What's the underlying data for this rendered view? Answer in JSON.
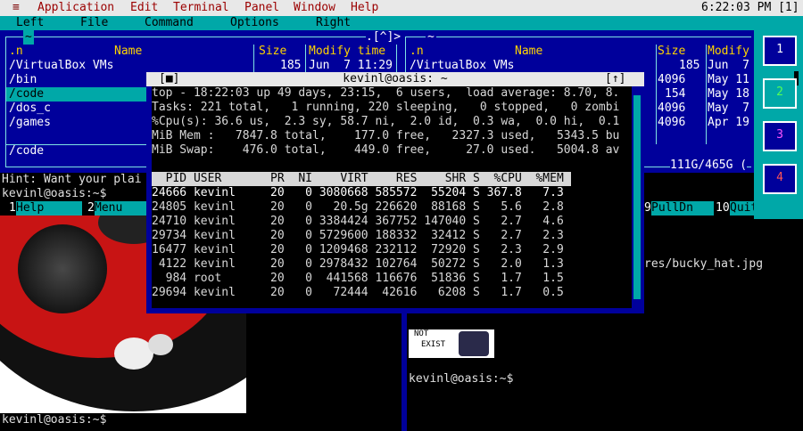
{
  "menubar": {
    "logo": "≡",
    "items": [
      "Application",
      "Edit",
      "Terminal",
      "Panel",
      "Window",
      "Help"
    ],
    "clock": "6:22:03 PM [1]"
  },
  "mc": {
    "menu": [
      "Left",
      "File",
      "Command",
      "Options",
      "Right"
    ],
    "left_panel": {
      "path": "~",
      "path_right": ".[^]>",
      "headers": [
        ".n",
        "Name",
        "Size",
        "Modify time"
      ],
      "rows": [
        {
          "name": "/VirtualBox VMs",
          "size": "185",
          "time": "Jun  7 11:29"
        },
        {
          "name": "/bin",
          "size": "",
          "time": ""
        },
        {
          "name": "/code",
          "size": "",
          "time": ""
        },
        {
          "name": "/dos_c",
          "size": "",
          "time": ""
        },
        {
          "name": "/games",
          "size": "",
          "time": ""
        }
      ],
      "status": "/code"
    },
    "right_panel": {
      "path": "~",
      "headers": [
        ".n",
        "Name",
        "Size",
        "Modify"
      ],
      "rows": [
        {
          "name": "/VirtualBox VMs",
          "size": "185",
          "time": "Jun  7"
        },
        {
          "name": "",
          "size": "4096",
          "time": "May 11"
        },
        {
          "name": "",
          "size": "154",
          "time": "May 18"
        },
        {
          "name": "",
          "size": "4096",
          "time": "May  7"
        },
        {
          "name": "",
          "size": "4096",
          "time": "Apr 19"
        }
      ],
      "disk": "111G/465G ("
    },
    "hint": "Hint: Want your plai",
    "prompt": "kevinl@oasis:~$",
    "fkeys": [
      {
        "n": "1",
        "label": "Help"
      },
      {
        "n": "2",
        "label": "Menu"
      },
      {
        "n": "9",
        "label": "PullDn"
      },
      {
        "n": "10",
        "label": "Quit"
      }
    ]
  },
  "top_window": {
    "title": "kevinl@oasis: ~",
    "left_btn": "[■]",
    "right_btn": "[↑]",
    "summary": [
      "top - 18:22:03 up 49 days, 23:15,  6 users,  load average: 8.70, 8.",
      "Tasks: 221 total,   1 running, 220 sleeping,   0 stopped,   0 zombi",
      "%Cpu(s): 36.6 us,  2.3 sy, 58.7 ni,  2.0 id,  0.3 wa,  0.0 hi,  0.1",
      "MiB Mem :   7847.8 total,    177.0 free,   2327.3 used,   5343.5 bu",
      "MiB Swap:    476.0 total,    449.0 free,     27.0 used.   5004.8 av"
    ],
    "header": "  PID USER       PR  NI    VIRT    RES    SHR S  %CPU  %MEM ",
    "procs": [
      "24666 kevinl     20   0 3080668 585572  55204 S 367.8   7.3",
      "24805 kevinl     20   0   20.5g 226620  88168 S   5.6   2.8",
      "24710 kevinl     20   0 3384424 367752 147040 S   2.7   4.6",
      "29734 kevinl     20   0 5729600 188332  32412 S   2.7   2.3",
      "16477 kevinl     20   0 1209468 232112  72920 S   2.3   2.9",
      " 4122 kevinl     20   0 2978432 102764  50272 S   2.0   1.3",
      "  984 root       20   0  441568 116676  51836 S   1.7   1.5",
      "29694 kevinl     20   0   72444  42616   6208 S   1.7   0.5"
    ]
  },
  "window_list": [
    "1",
    "2",
    "3",
    "4"
  ],
  "window_colors": [
    "#ff55ff",
    "#55ff55",
    "#ff55ff",
    "#ff5555"
  ],
  "lower_left": {
    "prompt": "kevinl@oasis:~$"
  },
  "lower_right": {
    "file_tail": "res/bucky_hat.jpg",
    "sticker_line1": "NOT",
    "sticker_line2": "EXIST",
    "prompt": "kevinl@oasis:~$"
  }
}
